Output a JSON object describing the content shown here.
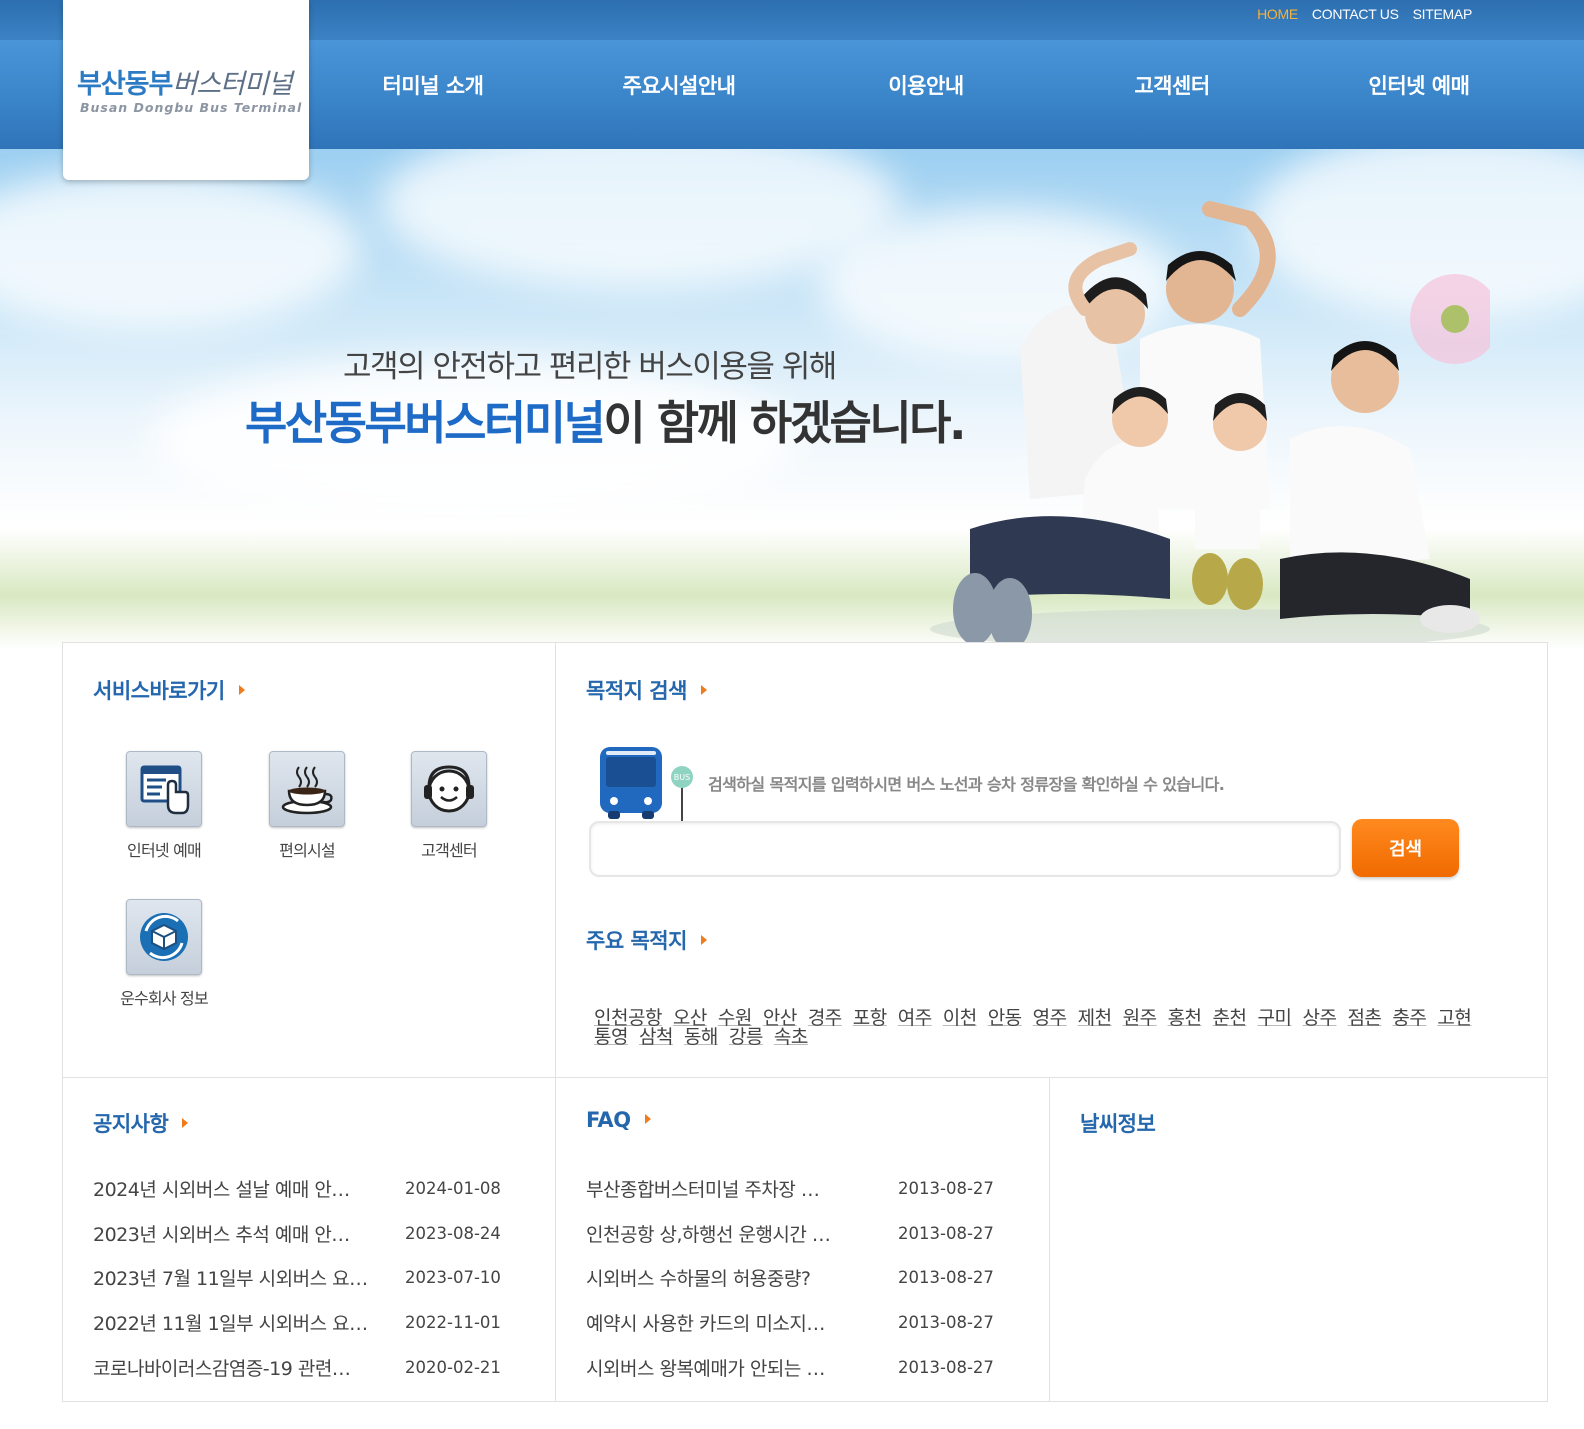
{
  "header": {
    "util_links": [
      "HOME",
      "CONTACT US",
      "SITEMAP"
    ],
    "active_util": "HOME",
    "logo_ko_a": "부산동부",
    "logo_ko_b": "버스터미널",
    "logo_en": "Busan Dongbu Bus Terminal",
    "nav": [
      "터미널 소개",
      "주요시설안내",
      "이용안내",
      "고객센터",
      "인터넷 예매"
    ]
  },
  "hero": {
    "subtitle": "고객의 안전하고 편리한 버스이용을 위해",
    "title_highlight": "부산동부버스터미널",
    "title_rest": "이 함께 하겠습니다."
  },
  "services": {
    "title": "서비스바로가기",
    "items": [
      {
        "label": "인터넷 예매",
        "icon": "online-booking-icon"
      },
      {
        "label": "편의시설",
        "icon": "coffee-cup-icon"
      },
      {
        "label": "고객센터",
        "icon": "headset-icon"
      },
      {
        "label": "운수회사 정보",
        "icon": "bus-company-icon"
      }
    ]
  },
  "search": {
    "title": "목적지 검색",
    "hint": "검색하실 목적지를 입력하시면 버스 노선과 승차 정류장을 확인하실 수 있습니다.",
    "bus_stop_text": "BUS",
    "input_value": "",
    "button_label": "검색"
  },
  "destinations": {
    "title": "주요 목적지",
    "items": [
      "인천공항",
      "오산",
      "수원",
      "안산",
      "경주",
      "포항",
      "여주",
      "이천",
      "안동",
      "영주",
      "제천",
      "원주",
      "홍천",
      "춘천",
      "구미",
      "상주",
      "점촌",
      "충주",
      "고현",
      "통영",
      "삼척",
      "동해",
      "강릉",
      "속초"
    ]
  },
  "notice": {
    "title": "공지사항",
    "items": [
      {
        "title": "2024년 시외버스 설날 예매 안…",
        "date": "2024-01-08"
      },
      {
        "title": "2023년 시외버스 추석 예매 안…",
        "date": "2023-08-24"
      },
      {
        "title": "2023년 7월 11일부 시외버스 요…",
        "date": "2023-07-10"
      },
      {
        "title": "2022년 11월 1일부 시외버스 요…",
        "date": "2022-11-01"
      },
      {
        "title": "코로나바이러스감염증-19 관련…",
        "date": "2020-02-21"
      }
    ]
  },
  "faq": {
    "title": "FAQ",
    "items": [
      {
        "title": "부산종합버스터미널 주차장 …",
        "date": "2013-08-27"
      },
      {
        "title": "인천공항 상,하행선 운행시간 …",
        "date": "2013-08-27"
      },
      {
        "title": "시외버스 수하물의 허용중량?",
        "date": "2013-08-27"
      },
      {
        "title": "예약시 사용한 카드의 미소지…",
        "date": "2013-08-27"
      },
      {
        "title": "시외버스 왕복예매가 안되는 …",
        "date": "2013-08-27"
      }
    ]
  },
  "weather": {
    "title": "날씨정보"
  },
  "colors": {
    "brand_blue": "#2467ad",
    "accent_orange": "#f07b1d",
    "nav_bg": "#3a84c9"
  }
}
